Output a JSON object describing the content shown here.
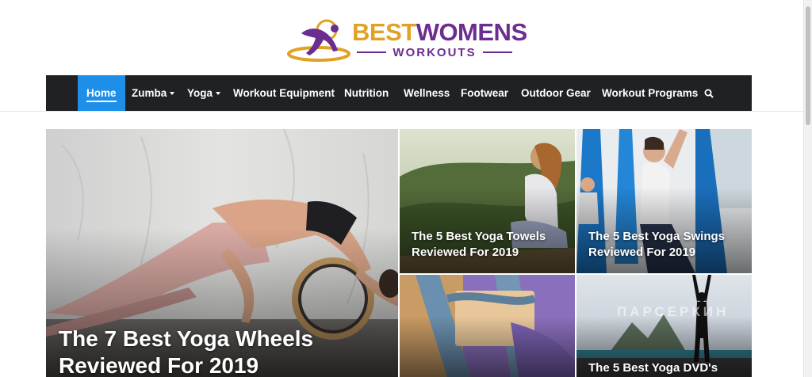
{
  "logo": {
    "brand_part1": "BEST",
    "brand_part2": "WOMENS",
    "sub": "WORKOUTS",
    "colors": {
      "gold": "#e0a225",
      "purple": "#6b2d90"
    }
  },
  "nav": {
    "items": [
      {
        "label": "Home",
        "active": true
      },
      {
        "label": "Zumba",
        "dropdown": true
      },
      {
        "label": "Yoga",
        "dropdown": true
      },
      {
        "label": "Workout Equipment"
      },
      {
        "label": "Nutrition"
      },
      {
        "label": "Wellness"
      },
      {
        "label": "Footwear"
      },
      {
        "label": "Outdoor Gear"
      },
      {
        "label": "Workout Programs"
      }
    ],
    "search_icon": "search-icon",
    "colors": {
      "bar": "#1f2125",
      "active": "#1e8fe8"
    }
  },
  "articles": [
    {
      "title": "The 7 Best Yoga Wheels Reviewed For 2019"
    },
    {
      "title": "The 5 Best Yoga Towels Reviewed For 2019"
    },
    {
      "title": "The 5 Best Yoga Swings Reviewed For 2019"
    },
    {
      "title": ""
    },
    {
      "title": "The 5 Best Yoga DVD's"
    }
  ],
  "watermark": "ПАРСЕРКИН"
}
